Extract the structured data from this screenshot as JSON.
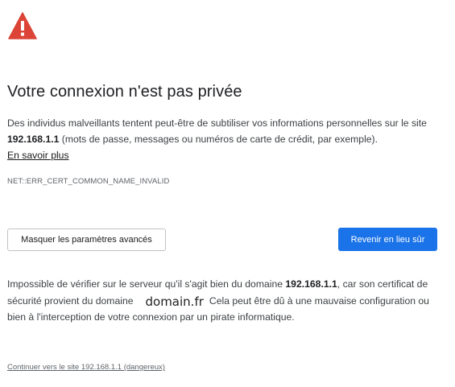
{
  "title": "Votre connexion n'est pas privée",
  "explanation": {
    "part1": "Des individus malveillants tentent peut-être de subtiliser vos informations personnelles sur le site ",
    "host": "192.168.1.1",
    "part2": " (mots de passe, messages ou numéros de carte de crédit, par exemple).",
    "learn_more": "En savoir plus"
  },
  "error_code": "NET::ERR_CERT_COMMON_NAME_INVALID",
  "buttons": {
    "advanced": "Masquer les paramètres avancés",
    "back": "Revenir en lieu sûr"
  },
  "details": {
    "part1": "Impossible de vérifier sur le serveur qu'il s'agit bien du domaine ",
    "host": "192.168.1.1",
    "part2": ", car son certificat de sécurité provient du domaine",
    "domain": "domain.fr",
    "part3": "Cela peut être dû à une mauvaise configuration ou bien à l'interception de votre connexion par un pirate informatique."
  },
  "proceed_link": "Continuer vers le site 192.168.1.1 (dangereux)",
  "colors": {
    "warning_red": "#db4437",
    "primary_blue": "#1a73e8"
  },
  "icons": {
    "warning": "warning-triangle-icon"
  }
}
